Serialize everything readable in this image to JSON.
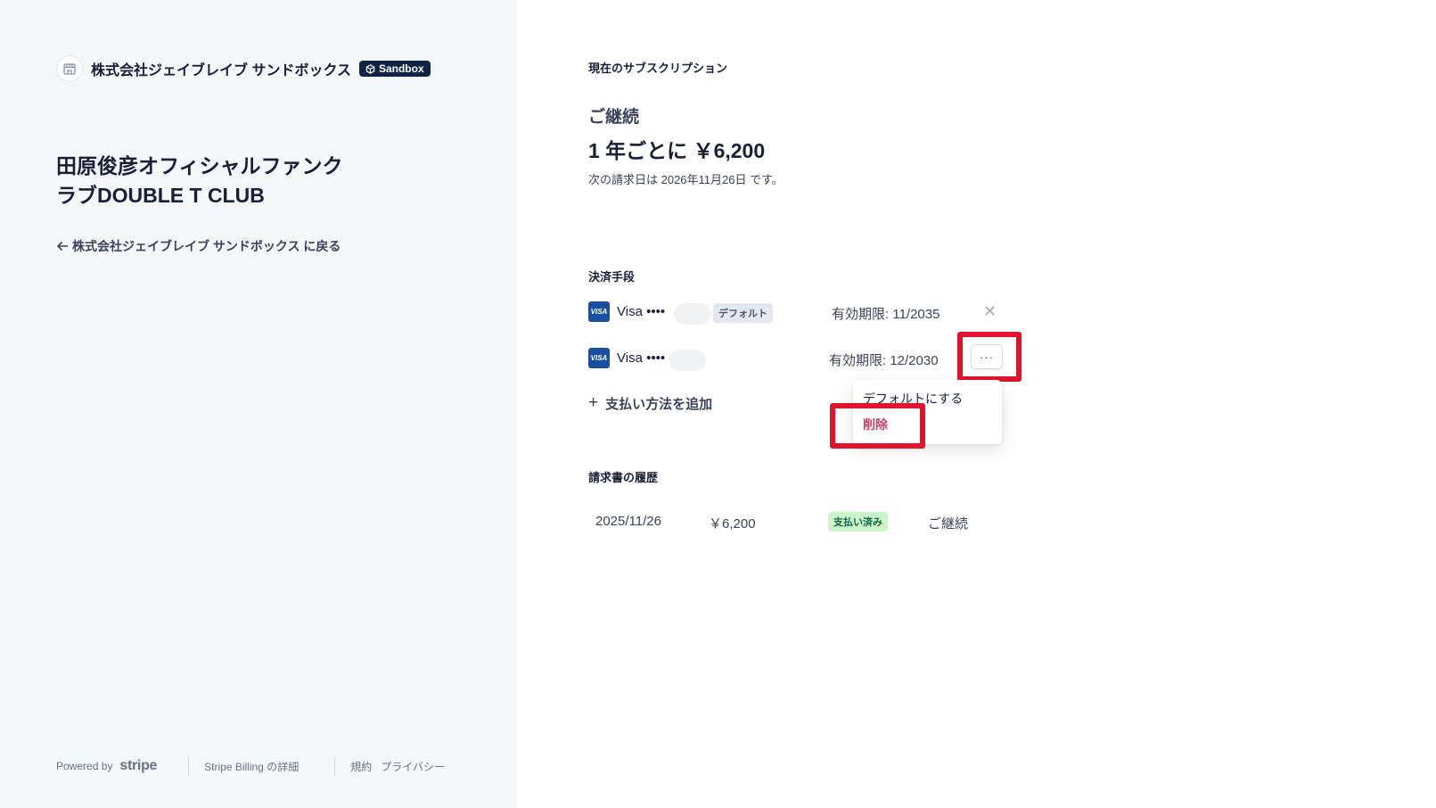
{
  "colors": {
    "accent": "#0f2344",
    "highlight": "#e0142c",
    "danger": "#cd3d64",
    "paid_bg": "#cbf4c9",
    "paid_text": "#0e6245"
  },
  "sidebar": {
    "company": "株式会社ジェイブレイブ サンドボックス",
    "sandbox_badge": "Sandbox",
    "product_name": "田原俊彦オフィシャルファンクラブDOUBLE T CLUB",
    "back_link": "株式会社ジェイブレイブ サンドボックス に戻る",
    "footer": {
      "powered_by": "Powered by",
      "stripe": "stripe",
      "billing_details": "Stripe Billing の詳細",
      "terms": "規約",
      "privacy": "プライバシー"
    }
  },
  "subscription": {
    "section_title": "現在のサブスクリプション",
    "status": "ご継続",
    "price": "1 年ごとに ￥6,200",
    "next_billing": "次の請求日は 2026年11月26日 です。"
  },
  "payment_methods": {
    "section_title": "決済手段",
    "cards": [
      {
        "logo": "VISA",
        "brand": "Visa ••••",
        "default_label": "デフォルト",
        "expiry": "有効期限: 11/2035"
      },
      {
        "logo": "VISA",
        "brand": "Visa ••••",
        "expiry": "有効期限: 12/2030"
      }
    ],
    "add_label": "支払い方法を追加",
    "more_label": "···",
    "menu": {
      "make_default": "デフォルトにする",
      "delete": "削除"
    }
  },
  "invoices": {
    "section_title": "請求書の履歴",
    "rows": [
      {
        "date": "2025/11/26",
        "amount": "￥6,200",
        "status": "支払い済み",
        "description": "ご継続"
      }
    ]
  }
}
